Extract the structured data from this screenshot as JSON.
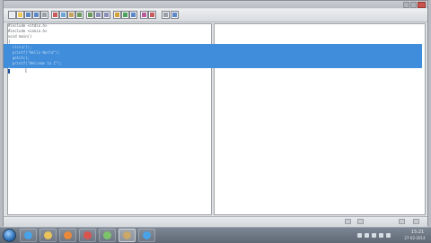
{
  "editor": {
    "lines": [
      {
        "text": "#include <stdio.h>",
        "selected": false
      },
      {
        "text": "#include <conio.h>",
        "selected": false
      },
      {
        "text": "void main()",
        "selected": false
      },
      {
        "text": "{",
        "selected": false
      },
      {
        "text": "  clrscr();",
        "selected": true
      },
      {
        "text": "  printf(\"Hello World\");",
        "selected": true
      },
      {
        "text": "  getch();",
        "selected": true
      },
      {
        "text": "  printf(\"Welcome to C\");",
        "selected": true
      },
      {
        "text": "}",
        "selected": true
      }
    ]
  },
  "toolbar": {
    "icons": [
      "new-icon",
      "open-icon",
      "save-icon",
      "save-all-icon",
      "print-icon",
      "cut-icon",
      "copy-icon",
      "paste-icon",
      "undo-icon",
      "redo-icon",
      "find-icon",
      "replace-icon",
      "compile-icon",
      "run-icon",
      "build-icon",
      "debug-icon",
      "stop-icon",
      "settings-icon",
      "help-icon"
    ]
  },
  "taskbar": {
    "items": [
      "ie-icon",
      "folder-icon",
      "media-player-icon",
      "chrome-icon",
      "paint-icon",
      "code-blocks-icon",
      "ie-icon"
    ],
    "active_index": 5,
    "clock_time": "15:21",
    "clock_date": "27-02-2014"
  },
  "colors": {
    "selection": "#3f8ddb",
    "taskbar": "#6b7480"
  }
}
